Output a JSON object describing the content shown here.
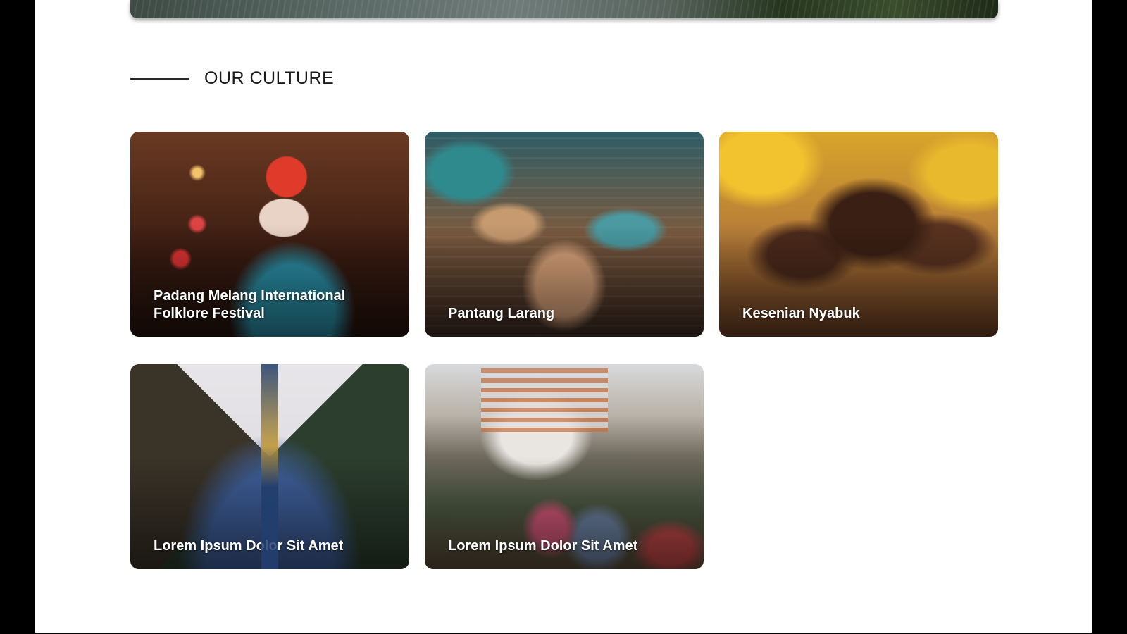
{
  "section": {
    "title": "OUR CULTURE"
  },
  "cards": [
    {
      "title": "Padang Melang International Folklore Festival"
    },
    {
      "title": "Pantang Larang"
    },
    {
      "title": "Kesenian Nyabuk"
    },
    {
      "title": "Lorem Ipsum Dolor Sit Amet"
    },
    {
      "title": "Lorem Ipsum Dolor Sit Amet"
    }
  ]
}
